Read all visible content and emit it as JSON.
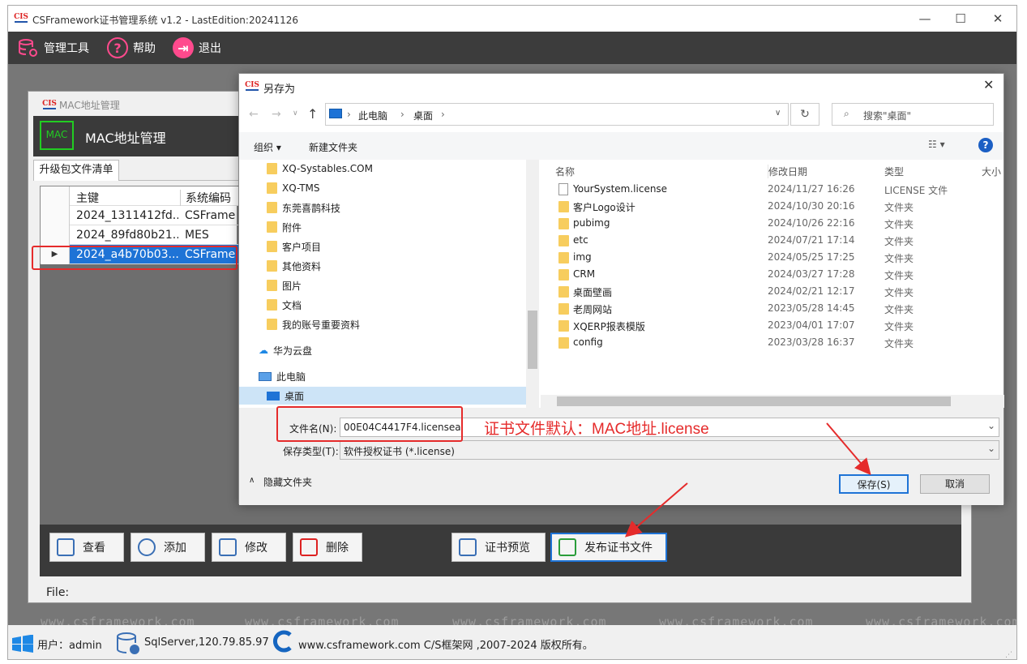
{
  "window": {
    "title": "CSFramework证书管理系统 v1.2 - LastEdition:20241126",
    "logo": "CIS",
    "controls": [
      "—",
      "☐",
      "✕"
    ]
  },
  "toolbar": {
    "items": [
      {
        "label": "管理工具",
        "icon": "database-gear-icon"
      },
      {
        "label": "帮助",
        "icon": "help-icon"
      },
      {
        "label": "退出",
        "icon": "exit-icon"
      }
    ]
  },
  "watermark": "www.csframework.com",
  "mac_window": {
    "title": "MAC地址管理",
    "header_title": "MAC地址管理",
    "header_icon_text": "MAC",
    "tab": "升级包文件清单",
    "grid": {
      "columns": [
        "主键",
        "系统编码"
      ],
      "rows": [
        {
          "key": "2024_1311412fd...",
          "code": "CSFrame"
        },
        {
          "key": "2024_89fd80b21...",
          "code": "MES"
        },
        {
          "key": "2024_a4b70b03...",
          "code": "CSFrame",
          "selected": true
        }
      ]
    },
    "actions": [
      {
        "label": "查看"
      },
      {
        "label": "添加"
      },
      {
        "label": "修改"
      },
      {
        "label": "删除"
      },
      {
        "label": "证书预览"
      },
      {
        "label": "发布证书文件"
      }
    ],
    "status_label": "File:"
  },
  "dialog": {
    "title": "另存为",
    "path": [
      "此电脑",
      "桌面"
    ],
    "search_placeholder": "搜索\"桌面\"",
    "organize": "组织 ▾",
    "new_folder": "新建文件夹",
    "tree": [
      {
        "label": "XQ-Systables.COM",
        "type": "folder"
      },
      {
        "label": "XQ-TMS",
        "type": "folder"
      },
      {
        "label": "东莞喜鹊科技",
        "type": "folder"
      },
      {
        "label": "附件",
        "type": "folder"
      },
      {
        "label": "客户项目",
        "type": "folder"
      },
      {
        "label": "其他资料",
        "type": "folder"
      },
      {
        "label": "图片",
        "type": "folder"
      },
      {
        "label": "文档",
        "type": "folder"
      },
      {
        "label": "我的账号重要资料",
        "type": "folder"
      },
      {
        "label": "华为云盘",
        "type": "cloud"
      },
      {
        "label": "此电脑",
        "type": "pc"
      },
      {
        "label": "桌面",
        "type": "desktop",
        "selected": true
      }
    ],
    "columns": [
      "名称",
      "修改日期",
      "类型",
      "大小"
    ],
    "files": [
      {
        "name": "YourSystem.license",
        "date": "2024/11/27 16:26",
        "type": "LICENSE 文件",
        "kind": "file"
      },
      {
        "name": "客户Logo设计",
        "date": "2024/10/30 20:16",
        "type": "文件夹",
        "kind": "folder"
      },
      {
        "name": "pubimg",
        "date": "2024/10/26 22:16",
        "type": "文件夹",
        "kind": "folder"
      },
      {
        "name": "etc",
        "date": "2024/07/21 17:14",
        "type": "文件夹",
        "kind": "folder"
      },
      {
        "name": "img",
        "date": "2024/05/25 17:25",
        "type": "文件夹",
        "kind": "folder"
      },
      {
        "name": "CRM",
        "date": "2024/03/27 17:28",
        "type": "文件夹",
        "kind": "folder"
      },
      {
        "name": "桌面壁画",
        "date": "2024/02/21 12:17",
        "type": "文件夹",
        "kind": "folder"
      },
      {
        "name": "老周网站",
        "date": "2023/05/28 14:45",
        "type": "文件夹",
        "kind": "folder"
      },
      {
        "name": "XQERP报表模版",
        "date": "2023/04/01 17:07",
        "type": "文件夹",
        "kind": "folder"
      },
      {
        "name": "config",
        "date": "2023/03/28 16:37",
        "type": "文件夹",
        "kind": "folder"
      }
    ],
    "filename_label": "文件名(N):",
    "filename_value": "00E04C4417F4.licensea",
    "filetype_label": "保存类型(T):",
    "filetype_value": "软件授权证书 (*.license)",
    "hide_folders": "隐藏文件夹",
    "save_button": "保存(S)",
    "cancel_button": "取消"
  },
  "annotation": "证书文件默认：MAC地址.license",
  "statusbar": {
    "user": "用户：admin",
    "db": "SqlServer,120.79.85.97",
    "copyright": "www.csframework.com C/S框架网 ,2007-2024 版权所有。"
  },
  "colors": {
    "annotation_red": "#e52b2b",
    "selected_row": "#1e73d6",
    "toolbar_bg": "#3c3c3c",
    "help_blue": "#1b5fc4"
  }
}
